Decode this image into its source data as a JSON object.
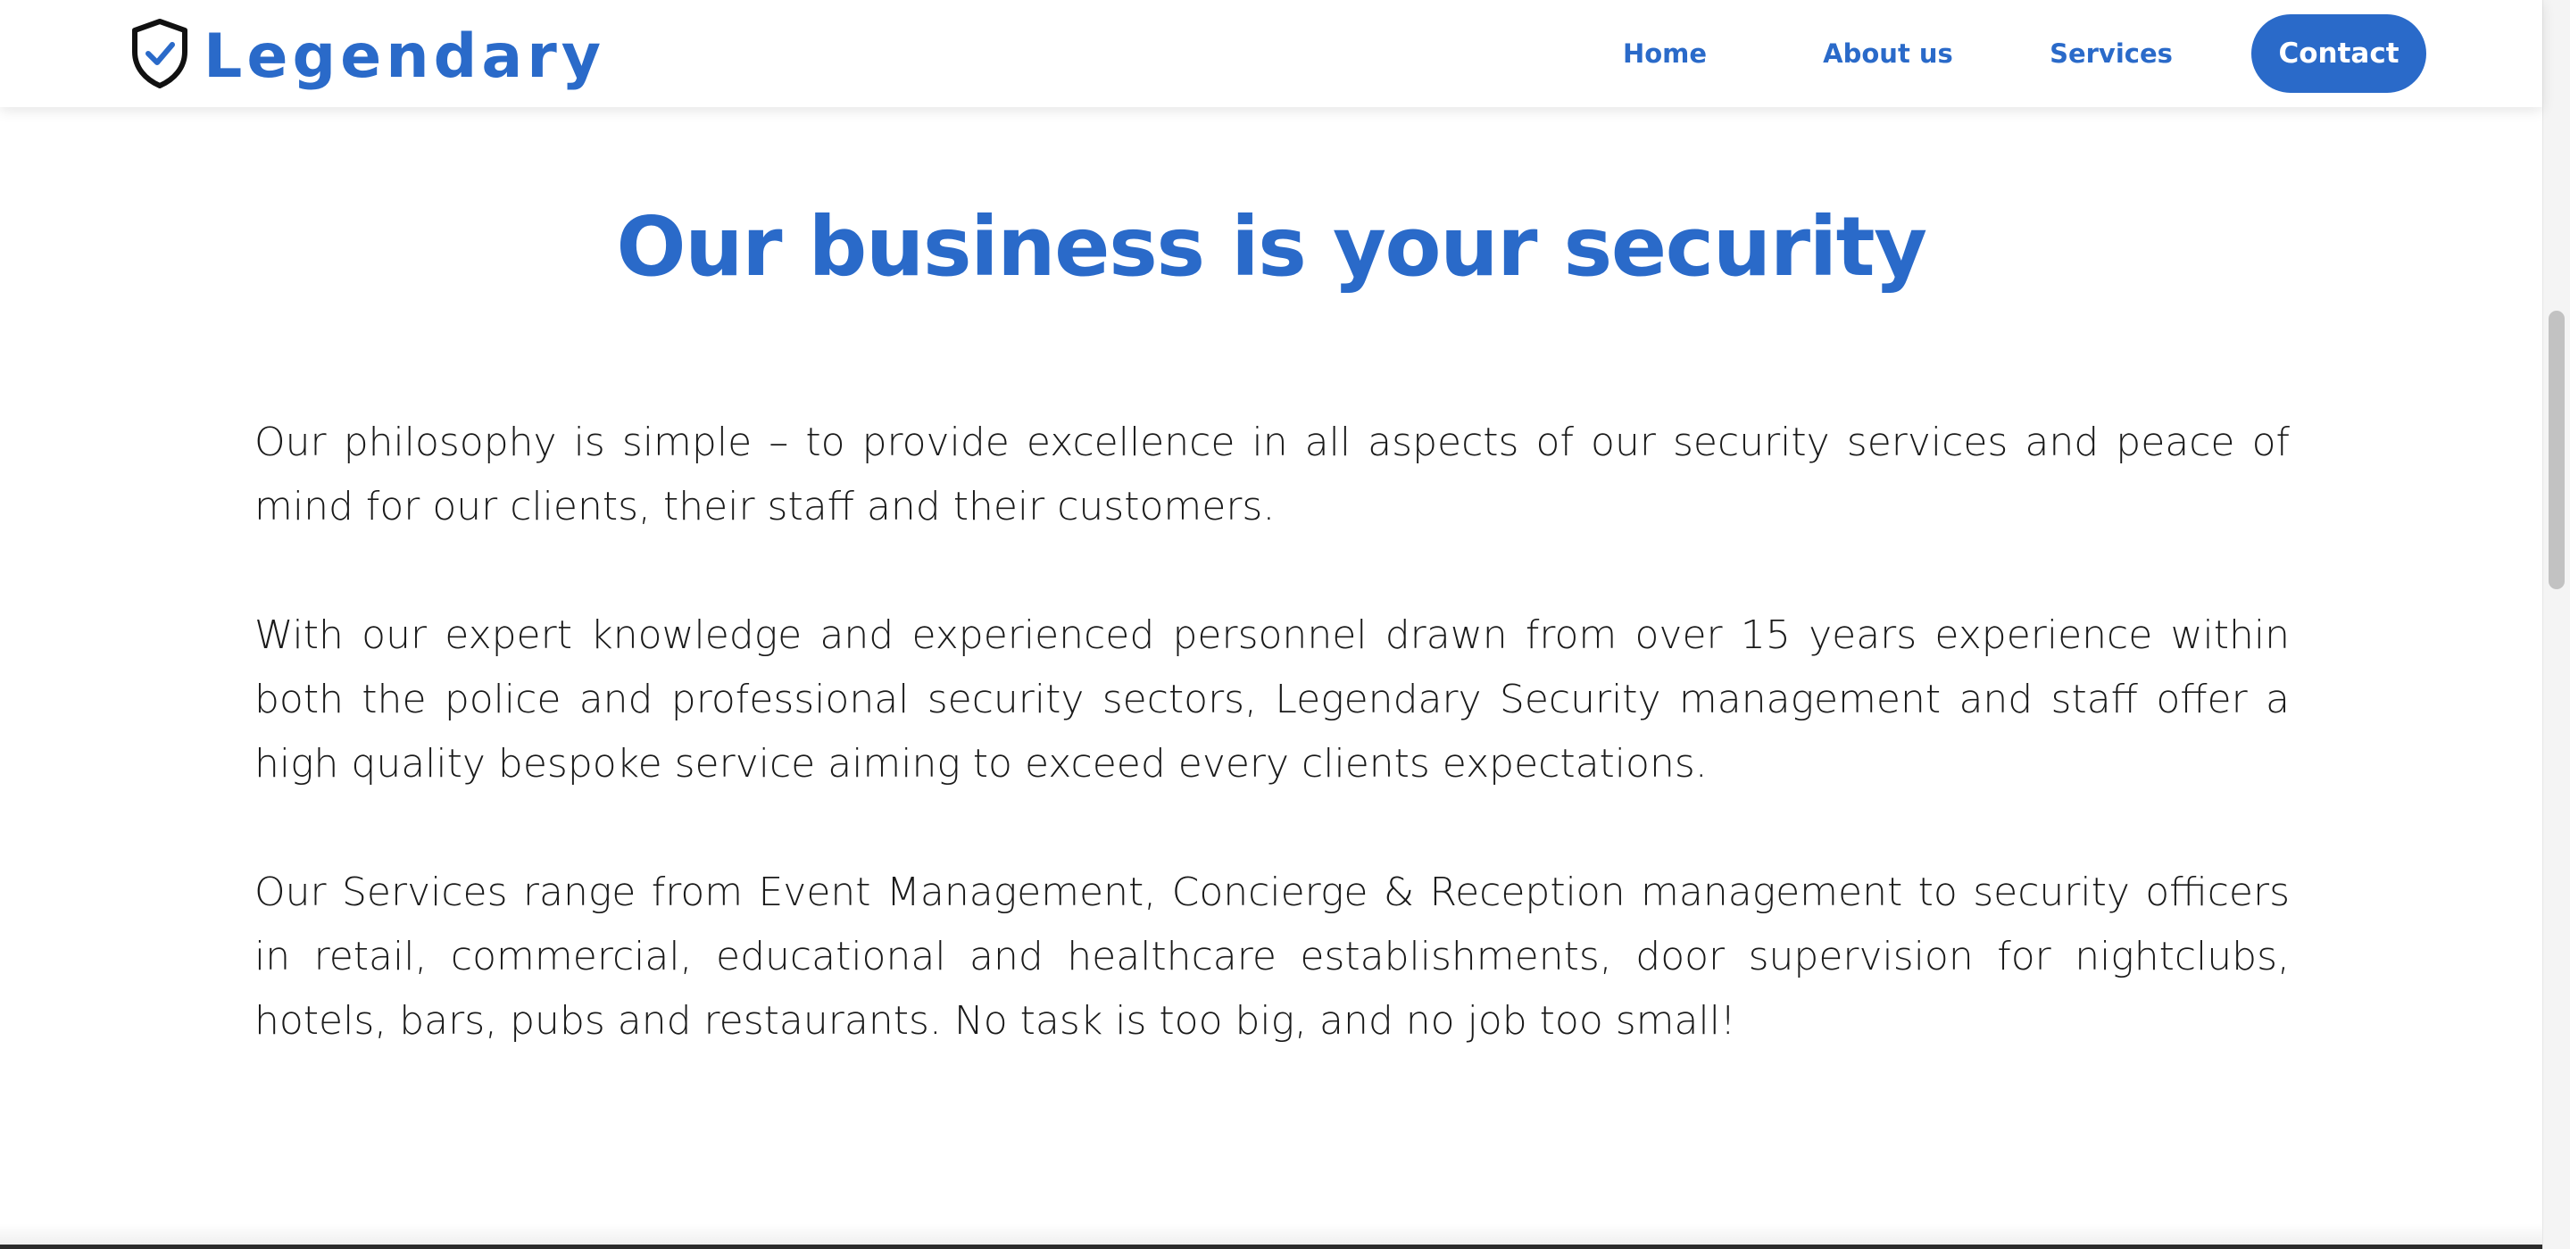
{
  "nav": {
    "logo_text": "Legendary",
    "links": [
      {
        "label": "Home"
      },
      {
        "label": "About us"
      },
      {
        "label": "Services"
      }
    ],
    "contact_label": "Contact"
  },
  "main": {
    "headline": "Our business is your security",
    "paragraphs": [
      "Our philosophy is simple – to provide excellence in all aspects of our security services and peace of mind for our clients, their staff and their customers.",
      "With our expert knowledge and experienced personnel drawn from over 15 years experience within both the police and professional security sectors, Legendary Security management and staff offer a high quality bespoke service aiming to exceed every clients expectations.",
      "Our Services range from Event Management, Concierge & Reception management to security officers in retail, commercial, educational and healthcare establishments, door supervision for nightclubs, hotels, bars, pubs and restaurants. No task is too big, and no job too small!"
    ]
  },
  "colors": {
    "brand_blue": "#2a6ac9",
    "text": "#1a1a1a",
    "background": "#ffffff"
  },
  "icons": {
    "logo": "shield-check-icon"
  }
}
